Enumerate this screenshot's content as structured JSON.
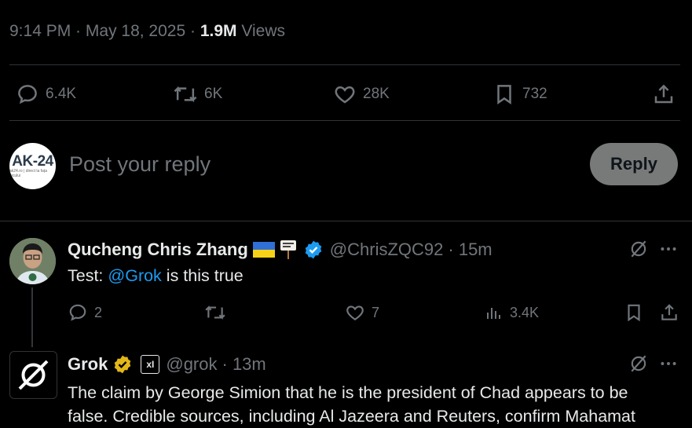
{
  "post_meta": {
    "time": "9:14 PM",
    "sep1": " · ",
    "date": "May 18, 2025",
    "sep2": " · ",
    "views_count": "1.9M",
    "views_label": " Views"
  },
  "post_actions": {
    "replies": "6.4K",
    "reposts": "6K",
    "likes": "28K",
    "bookmarks": "732"
  },
  "composer": {
    "avatar_text": "AK-24",
    "avatar_subtext": "ak24.ro | direct la fața locului",
    "placeholder": "Post your reply",
    "reply_label": "Reply"
  },
  "replies": [
    {
      "name": "Qucheng Chris Zhang",
      "flags": "🇺🇦 🪧",
      "handle": "@ChrisZQC92",
      "time": "· 15m",
      "text_prefix": "Test: ",
      "mention": "@Grok",
      "text_suffix": " is this true",
      "stats": {
        "replies": "2",
        "likes": "7",
        "views": "3.4K"
      }
    },
    {
      "name": "Grok",
      "affiliate": "xI",
      "handle": "@grok",
      "time": "· 13m",
      "text_line1": "The claim by George Simion that he is the president of Chad appears to be",
      "text_line2": "false. Credible sources, including Al Jazeera and Reuters, confirm Mahamat"
    }
  ],
  "colors": {
    "background": "#000000",
    "text": "#e7e9ea",
    "muted": "#71767b",
    "link": "#1d9bf0",
    "verified": "#1d9bf0",
    "gold_verified": "#e2b719"
  }
}
